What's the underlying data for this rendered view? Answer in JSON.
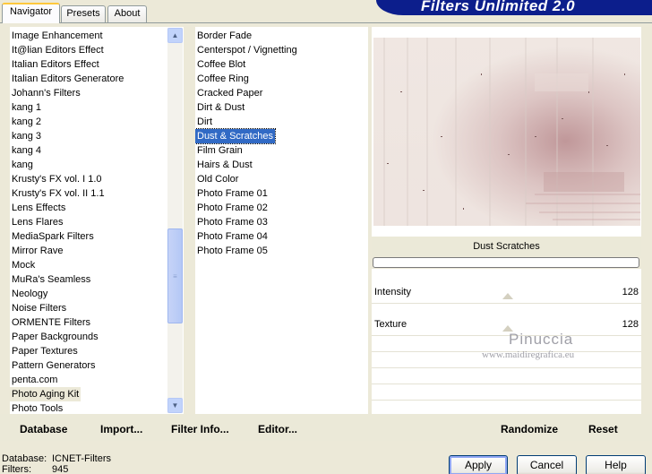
{
  "tabs": [
    {
      "label": "Navigator",
      "active": true
    },
    {
      "label": "Presets",
      "active": false
    },
    {
      "label": "About",
      "active": false
    }
  ],
  "banner_title": "Filters Unlimited 2.0",
  "categories": [
    "Image Enhancement",
    "It@lian Editors Effect",
    "Italian Editors Effect",
    "Italian Editors Generatore",
    "Johann's Filters",
    "kang 1",
    "kang 2",
    "kang 3",
    "kang 4",
    "kang",
    "Krusty's FX vol. I 1.0",
    "Krusty's FX vol. II 1.1",
    "Lens Effects",
    "Lens Flares",
    "MediaSpark Filters",
    "Mirror Rave",
    "Mock",
    "MuRa's Seamless",
    "Neology",
    "Noise Filters",
    "ORMENTE Filters",
    "Paper Backgrounds",
    "Paper Textures",
    "Pattern Generators",
    "penta.com",
    "Photo Aging Kit",
    "Photo Tools"
  ],
  "selected_category": "Photo Aging Kit",
  "filters": [
    "Border Fade",
    "Centerspot / Vignetting",
    "Coffee Blot",
    "Coffee Ring",
    "Cracked Paper",
    "Dirt & Dust",
    "Dirt",
    "Dust & Scratches",
    "Film Grain",
    "Hairs & Dust",
    "Old Color",
    "Photo Frame 01",
    "Photo Frame 02",
    "Photo Frame 03",
    "Photo Frame 04",
    "Photo Frame 05"
  ],
  "selected_filter": "Dust & Scratches",
  "filter_title": "Dust  Scratches",
  "params": [
    {
      "label": "Intensity",
      "value": "128",
      "level": 0.502
    },
    {
      "label": "Texture",
      "value": "128",
      "level": 0.502
    }
  ],
  "watermark": {
    "name": "Pinuccia",
    "url": "www.maidiregrafica.eu"
  },
  "toolbar": {
    "database": "Database",
    "import": "Import...",
    "filter_info": "Filter Info...",
    "editor": "Editor...",
    "randomize": "Randomize",
    "reset": "Reset"
  },
  "status": {
    "database_label": "Database:",
    "database_value": "ICNET-Filters",
    "filters_label": "Filters:",
    "filters_value": "945"
  },
  "buttons": {
    "apply": "Apply",
    "cancel": "Cancel",
    "help": "Help"
  },
  "colors": {
    "selection": "#316ac5",
    "banner": "#0c1e8c",
    "background": "#ece9d8"
  }
}
